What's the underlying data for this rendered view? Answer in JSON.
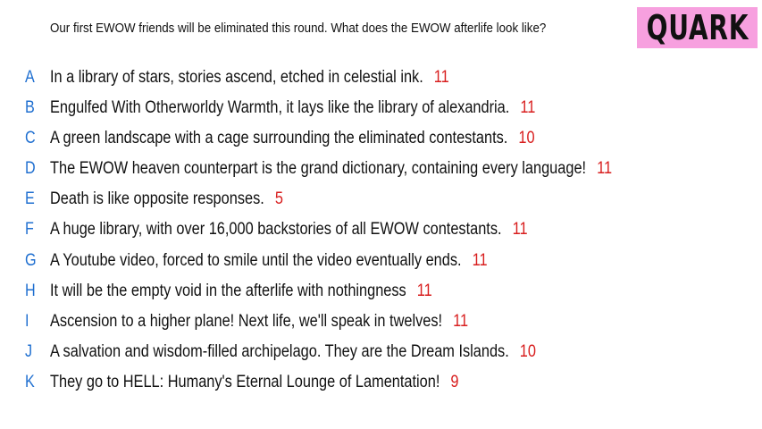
{
  "prompt": "Our first EWOW friends will be eliminated this round. What does the EWOW afterlife look like?",
  "badge": "QUARK",
  "colors": {
    "letter": "#1f6fd0",
    "score": "#d81e1e",
    "badge_background": "#f7a0df"
  },
  "responses": [
    {
      "letter": "A",
      "text": "In a library of stars, stories ascend, etched in celestial ink.",
      "score": "11"
    },
    {
      "letter": "B",
      "text": "Engulfed With Otherworldy Warmth, it lays like the library of alexandria.",
      "score": "11"
    },
    {
      "letter": "C",
      "text": "A green landscape with a cage surrounding the eliminated contestants.",
      "score": "10"
    },
    {
      "letter": "D",
      "text": "The EWOW heaven counterpart is the grand dictionary, containing every language!",
      "score": "11"
    },
    {
      "letter": "E",
      "text": "Death is like opposite responses.",
      "score": "5"
    },
    {
      "letter": "F",
      "text": "A huge library, with over 16,000 backstories of all EWOW contestants.",
      "score": "11"
    },
    {
      "letter": "G",
      "text": "A Youtube video, forced to smile until the video eventually ends.",
      "score": "11"
    },
    {
      "letter": "H",
      "text": "It will be the empty void in the afterlife with nothingness",
      "score": "11"
    },
    {
      "letter": "I",
      "text": "Ascension to a higher plane! Next life, we'll speak in twelves!",
      "score": "11"
    },
    {
      "letter": "J",
      "text": "A salvation and wisdom-filled archipelago. They are the Dream Islands.",
      "score": "10"
    },
    {
      "letter": "K",
      "text": "They go to HELL: Humany's Eternal Lounge of Lamentation!",
      "score": "9"
    }
  ]
}
